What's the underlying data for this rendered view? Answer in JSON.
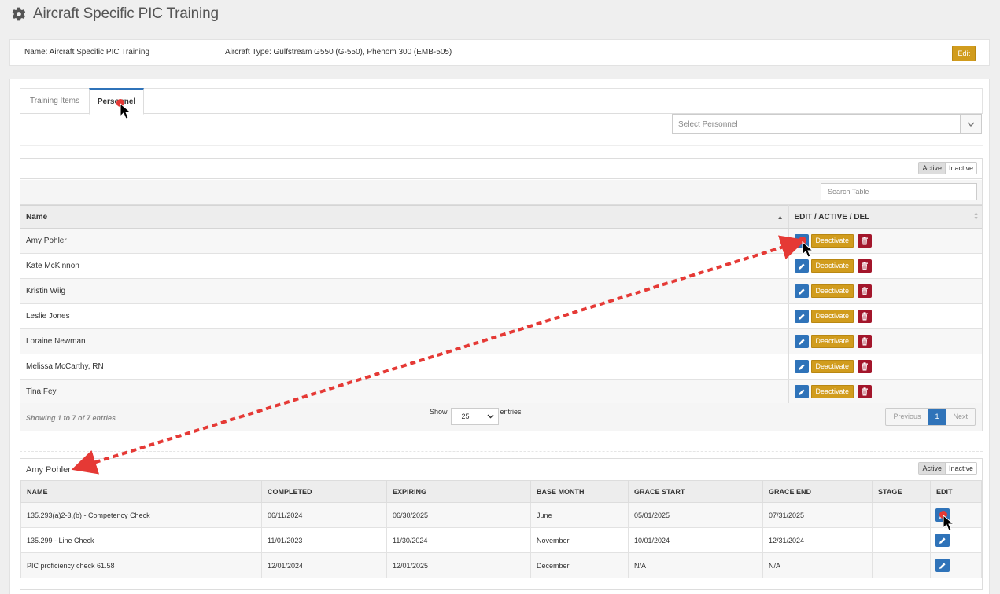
{
  "page": {
    "title": "Aircraft Specific PIC Training",
    "icon": "gear-icon"
  },
  "info": {
    "name": "Name: Aircraft Specific PIC Training",
    "aircraft_type": "Aircraft Type: Gulfstream G550 (G-550), Phenom 300 (EMB-505)",
    "edit_label": "Edit"
  },
  "tabs": [
    {
      "label": "Training Items",
      "active": false
    },
    {
      "label": "Personnel",
      "active": true
    }
  ],
  "personnel_select": {
    "placeholder": "Select Personnel"
  },
  "personnel_table": {
    "toggle": {
      "active": "Active",
      "inactive": "Inactive"
    },
    "search_placeholder": "Search Table",
    "columns": [
      "Name",
      "EDIT / ACTIVE / DEL"
    ],
    "deactivate_label": "Deactivate",
    "rows": [
      "Amy Pohler",
      "Kate McKinnon",
      "Kristin Wiig",
      "Leslie Jones",
      "Loraine Newman",
      "Melissa McCarthy, RN",
      "Tina Fey"
    ],
    "footer": {
      "info": "Showing 1 to 7 of 7 entries",
      "show": "Show",
      "entries_value": "25",
      "entries": "entries",
      "prev": "Previous",
      "page": "1",
      "next": "Next"
    }
  },
  "detail": {
    "title": "Amy Pohler",
    "toggle": {
      "active": "Active",
      "inactive": "Inactive"
    },
    "columns": [
      "NAME",
      "COMPLETED",
      "EXPIRING",
      "BASE MONTH",
      "GRACE START",
      "GRACE END",
      "STAGE",
      "EDIT"
    ],
    "rows": [
      {
        "name": "135.293(a)2-3,(b) - Competency Check",
        "completed": "06/11/2024",
        "expiring": "06/30/2025",
        "base_month": "June",
        "grace_start": "05/01/2025",
        "grace_end": "07/31/2025",
        "stage": ""
      },
      {
        "name": "135.299 - Line Check",
        "completed": "11/01/2023",
        "expiring": "11/30/2024",
        "base_month": "November",
        "grace_start": "10/01/2024",
        "grace_end": "12/31/2024",
        "stage": ""
      },
      {
        "name": "PIC proficiency check 61.58",
        "completed": "12/01/2024",
        "expiring": "12/01/2025",
        "base_month": "December",
        "grace_start": "N/A",
        "grace_end": "N/A",
        "stage": ""
      }
    ]
  },
  "colors": {
    "primary": "#2f73b9",
    "warning": "#d19c1d",
    "danger": "#a3162b",
    "annotation": "#e53935"
  }
}
